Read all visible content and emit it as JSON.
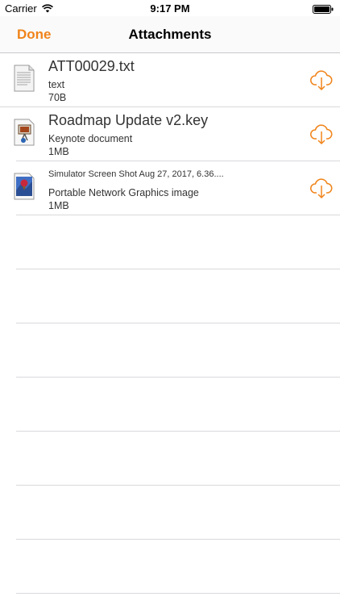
{
  "status_bar": {
    "carrier": "Carrier",
    "time": "9:17 PM"
  },
  "nav": {
    "done_label": "Done",
    "title": "Attachments"
  },
  "colors": {
    "accent": "#f0841a",
    "separator": "#d9d9dc"
  },
  "attachments": [
    {
      "name": "ATT00029.txt",
      "type": "text",
      "size": "70B",
      "icon": "text-file-icon"
    },
    {
      "name": "Roadmap Update v2.key",
      "type": "Keynote document",
      "size": "1MB",
      "icon": "keynote-file-icon"
    },
    {
      "name": "Simulator Screen Shot Aug 27, 2017, 6.36....",
      "type": "Portable Network Graphics image",
      "size": "1MB",
      "icon": "png-image-icon"
    }
  ]
}
